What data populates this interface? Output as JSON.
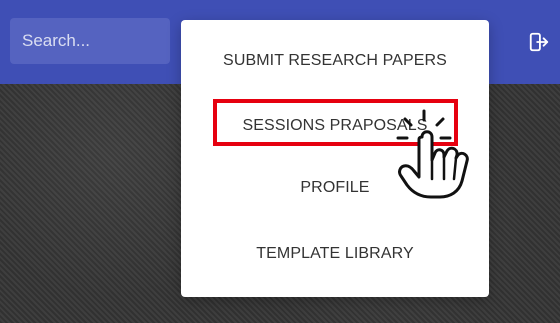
{
  "search": {
    "placeholder": "Search..."
  },
  "toolbar": {
    "logout_icon": "logout-icon"
  },
  "menu": {
    "items": [
      {
        "label": "SUBMIT RESEARCH PAPERS"
      },
      {
        "label": "SESSIONS PRAPOSALS"
      },
      {
        "label": "PROFILE"
      },
      {
        "label": "TEMPLATE LIBRARY"
      }
    ]
  },
  "annotation": {
    "pointer_icon": "pointing-hand-icon",
    "highlight_color": "#e6000f"
  },
  "colors": {
    "topbar": "#3f4fb5",
    "search": "#5563c0",
    "menu_text": "#333333"
  }
}
